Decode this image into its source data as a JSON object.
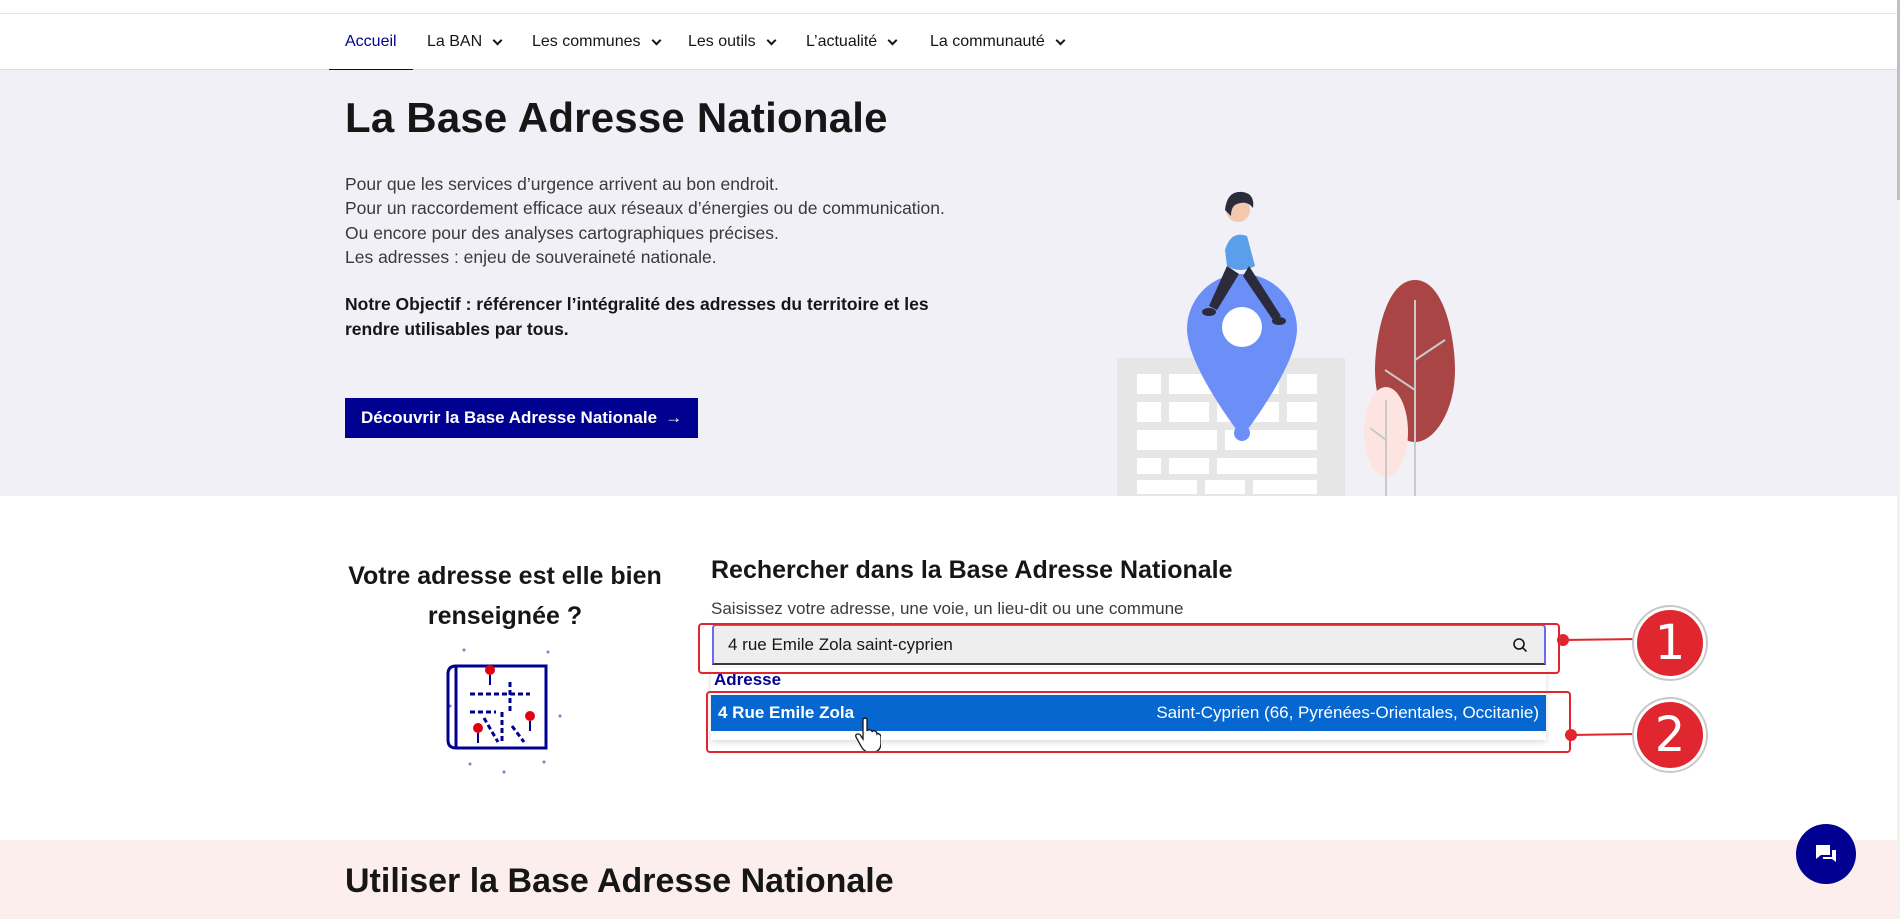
{
  "nav": {
    "items": [
      {
        "label": "Accueil",
        "active": true
      },
      {
        "label": "La BAN",
        "dropdown": true
      },
      {
        "label": "Les communes",
        "dropdown": true
      },
      {
        "label": "Les outils",
        "dropdown": true
      },
      {
        "label": "L’actualité",
        "dropdown": true
      },
      {
        "label": "La communauté",
        "dropdown": true
      }
    ]
  },
  "hero": {
    "title": "La Base Adresse Nationale",
    "lines": [
      "Pour que les services d’urgence arrivent au bon endroit.",
      "Pour un raccordement efficace aux réseaux d’énergies ou de communication.",
      "Ou encore pour des analyses cartographiques précises.",
      "Les adresses : enjeu de souveraineté nationale."
    ],
    "goal_label": "Notre Objectif :",
    "goal_text": "référencer l’intégralité des adresses du territoire et les rendre utilisables par tous.",
    "button_label": "Découvrir la Base Adresse Nationale",
    "button_arrow": "→"
  },
  "check": {
    "title": "Votre adresse est elle bien renseignée ?"
  },
  "search": {
    "title": "Rechercher dans la Base Adresse Nationale",
    "hint": "Saisissez votre adresse, une voie, un lieu-dit ou une commune",
    "value": "4 rue Emile Zola saint-cyprien",
    "dropdown": {
      "header": "Adresse",
      "results": [
        {
          "street": "4 Rue Emile Zola",
          "commune": "Saint-Cyprien (66, Pyrénées-Orientales, Occitanie)"
        }
      ]
    }
  },
  "annotations": {
    "badge1": "1",
    "badge2": "2"
  },
  "bottom": {
    "title": "Utiliser la Base Adresse Nationale"
  },
  "colors": {
    "brand": "#000091",
    "highlight": "#0567cf",
    "annotation": "#e0262e",
    "hero_bg": "#f0f0f6",
    "bottom_bg": "#fdeeee"
  }
}
